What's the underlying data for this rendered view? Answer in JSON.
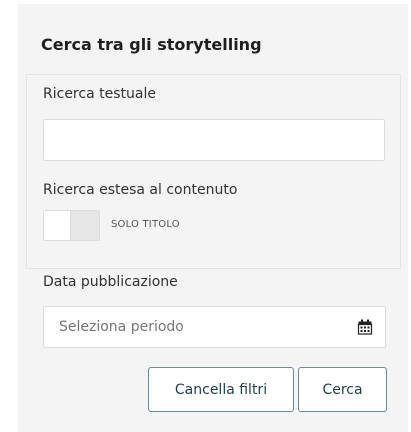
{
  "panel": {
    "title": "Cerca tra gli storytelling"
  },
  "text_search": {
    "label": "Ricerca testuale",
    "value": "",
    "placeholder": ""
  },
  "extended_search": {
    "label": "Ricerca estesa al contenuto",
    "toggle_state": "off",
    "toggle_label": "SOLO TITOLO"
  },
  "publication_date": {
    "label": "Data pubblicazione",
    "placeholder": "Seleziona periodo",
    "icon": "calendar-icon"
  },
  "actions": {
    "clear_label": "Cancella filtri",
    "search_label": "Cerca"
  },
  "colors": {
    "panel_background": "#f4f4f4",
    "button_border": "#6a8c93",
    "button_text": "#1f3f48"
  }
}
